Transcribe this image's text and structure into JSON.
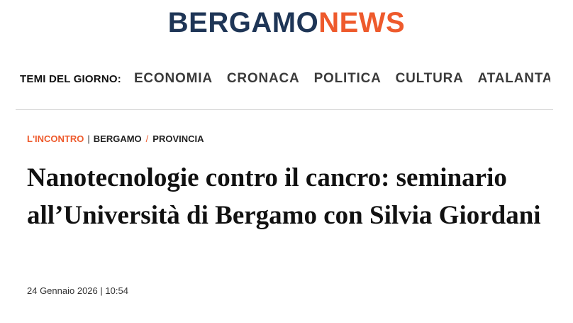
{
  "logo": {
    "part1": "BERGAMO",
    "part2": "NEWS"
  },
  "nav": {
    "label": "TEMI DEL GIORNO:",
    "items": [
      "ECONOMIA",
      "CRONACA",
      "POLITICA",
      "CULTURA",
      "ATALANTA"
    ]
  },
  "breadcrumb": {
    "category": "L'INCONTRO",
    "separator": "|",
    "location1": "BERGAMO",
    "slash": "/",
    "location2": "PROVINCIA"
  },
  "article": {
    "title": "Nanotecnologie contro il cancro: seminario all’Università di Bergamo con Silvia Giordani",
    "date": "24 Gennaio 2026",
    "date_separator": "|",
    "time": "10:54"
  },
  "colors": {
    "brand_dark": "#1e3556",
    "brand_accent": "#ee5a2c"
  }
}
